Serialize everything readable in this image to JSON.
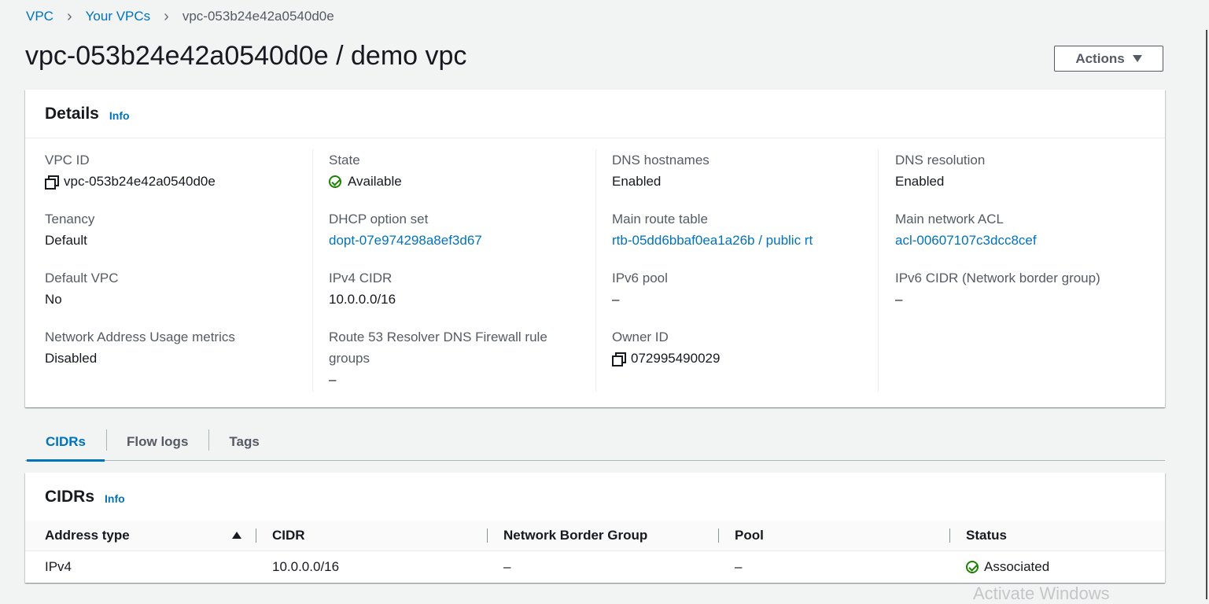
{
  "breadcrumb": {
    "items": [
      "VPC",
      "Your VPCs"
    ],
    "current": "vpc-053b24e42a0540d0e"
  },
  "page": {
    "title": "vpc-053b24e42a0540d0e / demo vpc",
    "actions_label": "Actions"
  },
  "details": {
    "title": "Details",
    "info": "Info",
    "columns": [
      [
        {
          "label": "VPC ID",
          "value": "vpc-053b24e42a0540d0e",
          "icon": "copy-icon"
        },
        {
          "label": "Tenancy",
          "value": "Default"
        },
        {
          "label": "Default VPC",
          "value": "No"
        },
        {
          "label": "Network Address Usage metrics",
          "value": "Disabled"
        }
      ],
      [
        {
          "label": "State",
          "value": "Available",
          "icon": "check-circle-icon"
        },
        {
          "label": "DHCP option set",
          "value": "dopt-07e974298a8ef3d67",
          "link": true
        },
        {
          "label": "IPv4 CIDR",
          "value": "10.0.0.0/16"
        },
        {
          "label": "Route 53 Resolver DNS Firewall rule groups",
          "value": "–"
        }
      ],
      [
        {
          "label": "DNS hostnames",
          "value": "Enabled"
        },
        {
          "label": "Main route table",
          "value": "rtb-05dd6bbaf0ea1a26b / public rt",
          "link": true
        },
        {
          "label": "IPv6 pool",
          "value": "–"
        },
        {
          "label": "Owner ID",
          "value": "072995490029",
          "icon": "copy-icon"
        }
      ],
      [
        {
          "label": "DNS resolution",
          "value": "Enabled"
        },
        {
          "label": "Main network ACL",
          "value": "acl-00607107c3dcc8cef",
          "link": true
        },
        {
          "label": "IPv6 CIDR (Network border group)",
          "value": "–"
        }
      ]
    ]
  },
  "tabs": [
    "CIDRs",
    "Flow logs",
    "Tags"
  ],
  "cidrs": {
    "title": "CIDRs",
    "info": "Info",
    "columns": [
      "Address type",
      "CIDR",
      "Network Border Group",
      "Pool",
      "Status"
    ],
    "rows": [
      {
        "address_type": "IPv4",
        "cidr": "10.0.0.0/16",
        "network_border_group": "–",
        "pool": "–",
        "status": "Associated"
      }
    ]
  },
  "overlay": {
    "watermark": "Activate Windows"
  },
  "colors": {
    "link": "#0073bb",
    "success": "#1d8102",
    "background": "#f2f3f3"
  }
}
